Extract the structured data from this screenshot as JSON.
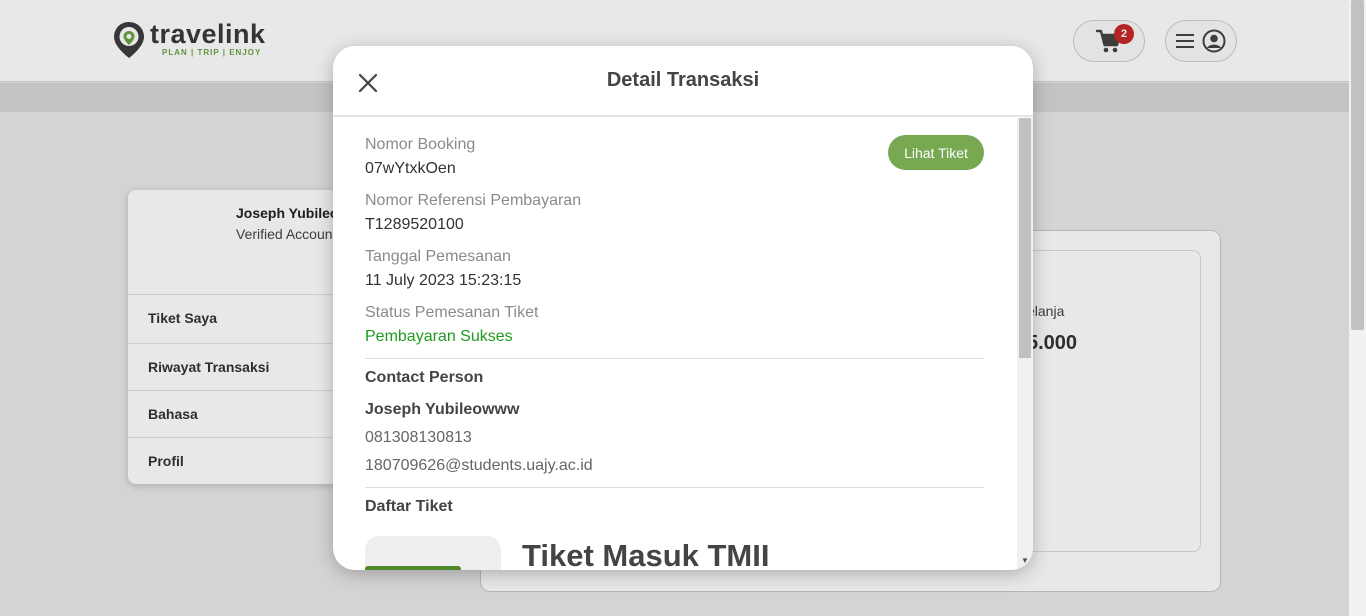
{
  "brand": {
    "name": "travelink",
    "tagline": "PLAN | TRIP | ENJOY"
  },
  "header": {
    "cart_count": "2",
    "cart_icon": "cart-icon",
    "menu_icon": "hamburger-icon",
    "account_icon": "user-circle-icon"
  },
  "sidebar": {
    "user_name": "Joseph Yubileo",
    "user_status": "Verified Accoun",
    "items": [
      {
        "label": "Tiket Saya"
      },
      {
        "label": "Riwayat Transaksi"
      },
      {
        "label": "Bahasa"
      },
      {
        "label": "Profil"
      }
    ]
  },
  "stats": {
    "label": "elanja",
    "value": "5.000"
  },
  "modal": {
    "title": "Detail Transaksi",
    "close_icon": "close-icon",
    "view_ticket_button": "Lihat Tiket",
    "booking_number_label": "Nomor Booking",
    "booking_number": "07wYtxkOen",
    "payment_ref_label": "Nomor Referensi Pembayaran",
    "payment_ref": "T1289520100",
    "order_date_label": "Tanggal Pemesanan",
    "order_date": "11 July 2023 15:23:15",
    "status_label": "Status Pemesanan Tiket",
    "status": "Pembayaran Sukses",
    "contact": {
      "section_title": "Contact Person",
      "name": "Joseph Yubileowww",
      "phone": "081308130813",
      "email": "180709626@students.uajy.ac.id"
    },
    "tickets": {
      "section_title": "Daftar Tiket",
      "items": [
        {
          "title": "Tiket Masuk TMII"
        }
      ]
    }
  },
  "colors": {
    "brand_green": "#78a852",
    "success_green": "#1f9a1f",
    "badge_red": "#c62828"
  }
}
